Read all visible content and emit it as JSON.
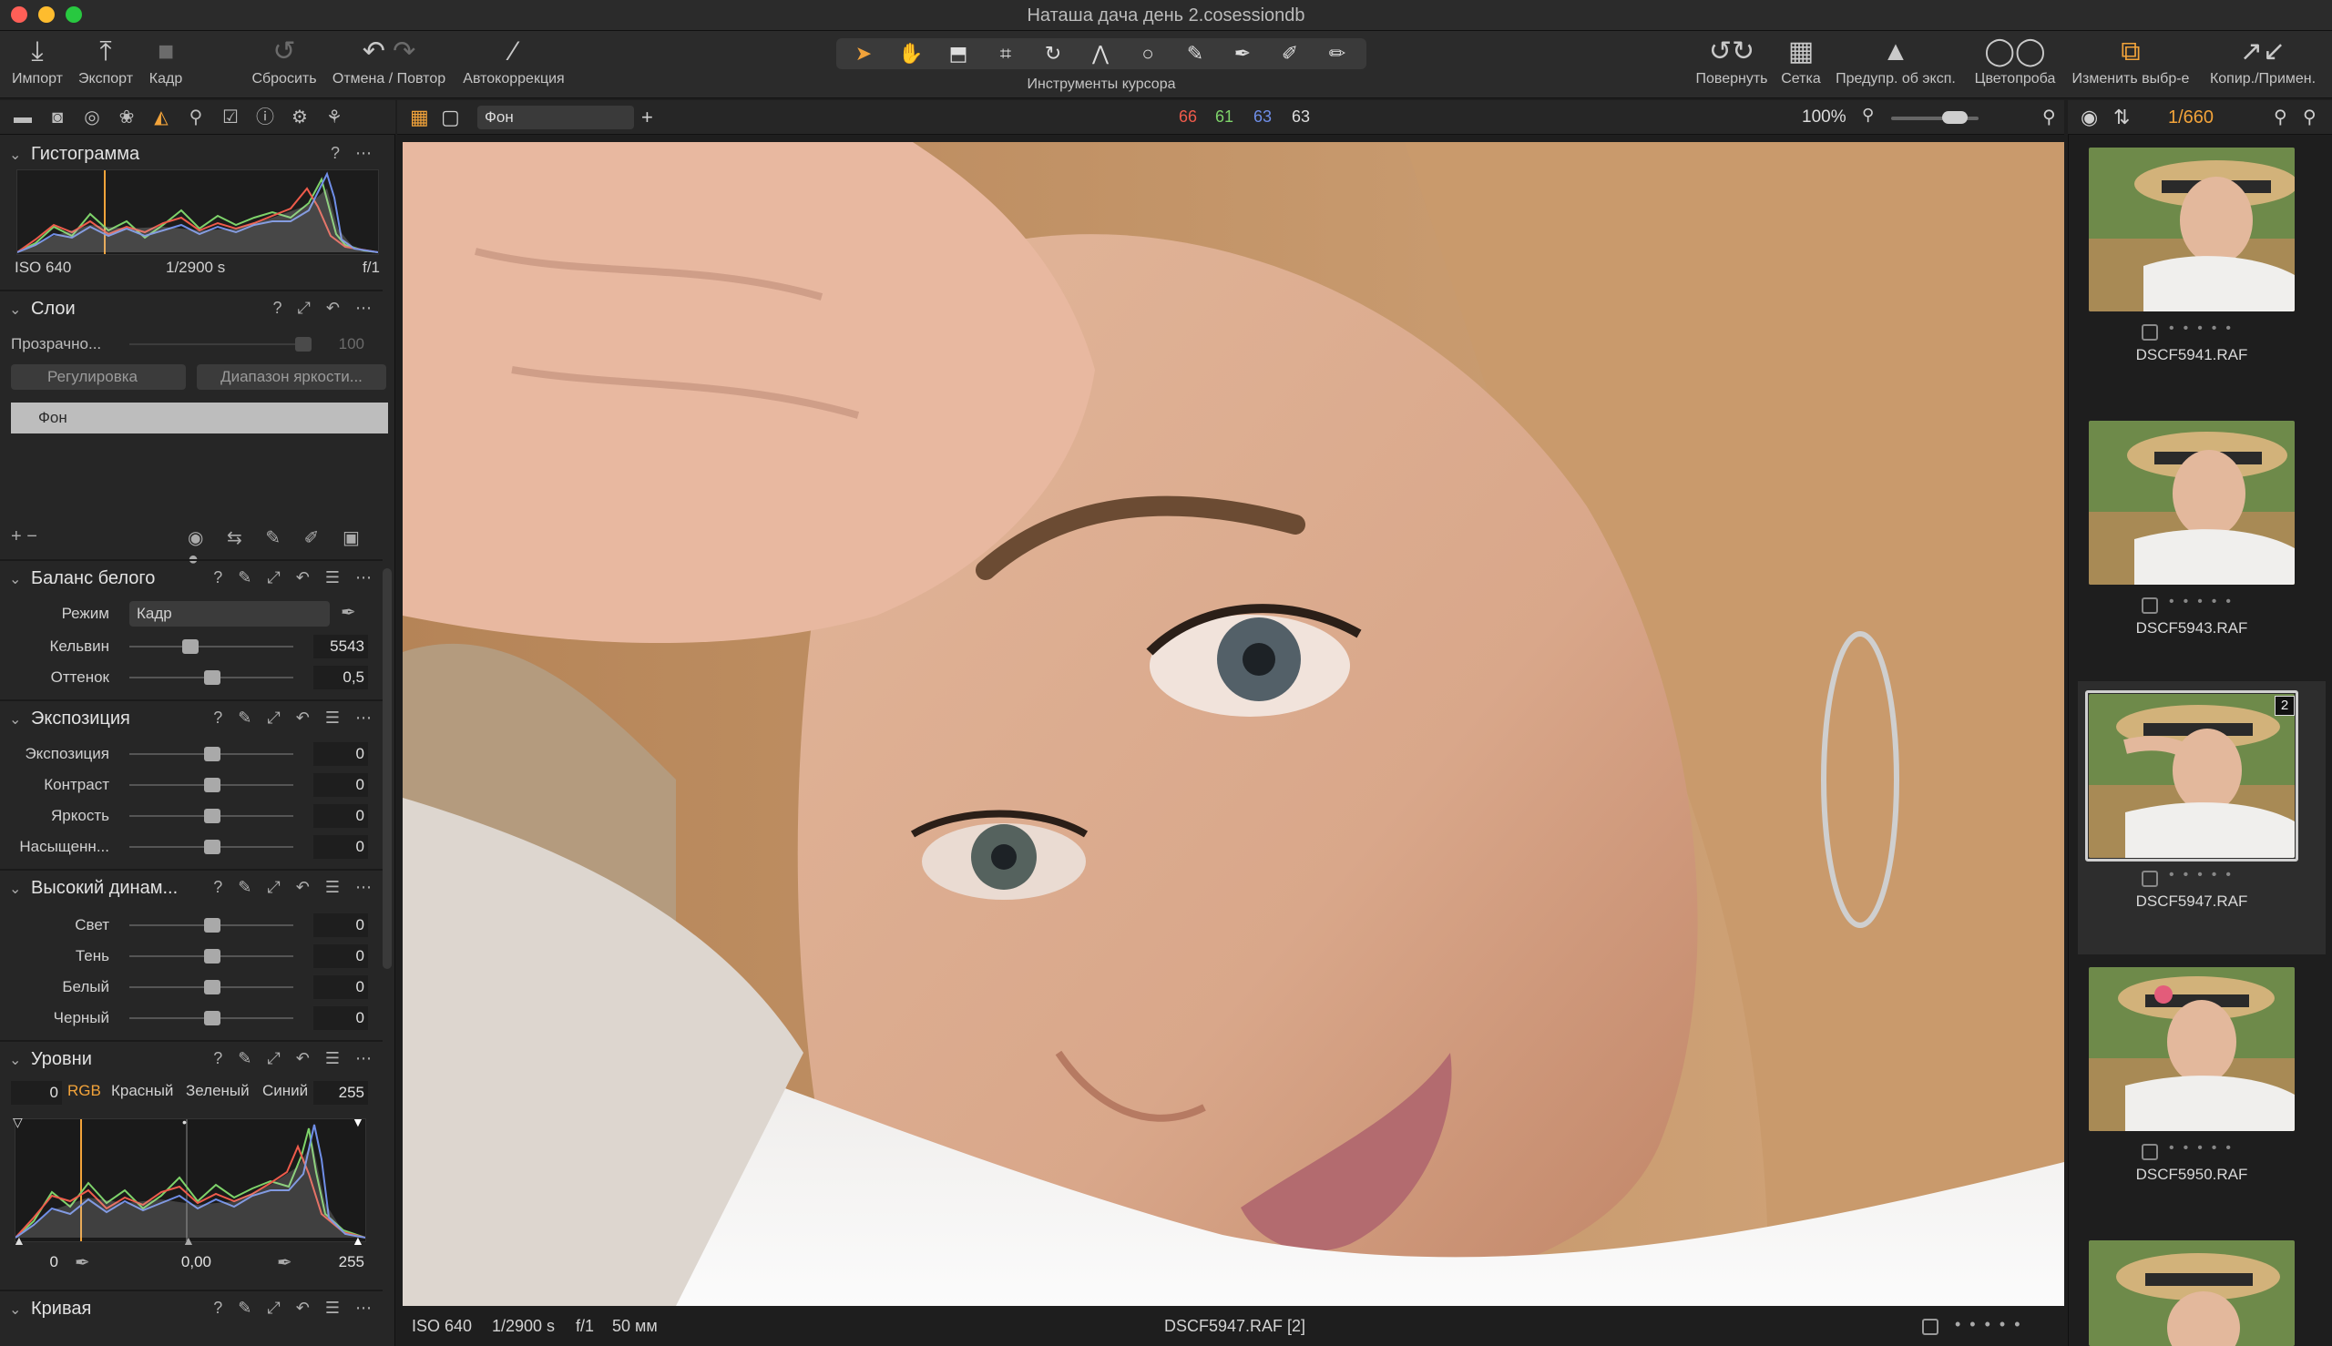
{
  "window": {
    "title": "Наташа дача день 2.cosessiondb"
  },
  "toolbar": {
    "import": "Импорт",
    "export": "Экспорт",
    "capture": "Кадр",
    "reset": "Сбросить",
    "undo_redo": "Отмена / Повтор",
    "autocorrect": "Автокоррекция",
    "cursor_tools": "Инструменты курсора",
    "rotate": "Повернуть",
    "grid": "Сетка",
    "exposure_warning": "Предупр. об эксп.",
    "proof": "Цветопроба",
    "edit_selection": "Изменить выбр-е",
    "copy_apply": "Копир./Примен."
  },
  "histogram": {
    "title": "Гистограмма",
    "iso": "ISO 640",
    "shutter": "1/2900 s",
    "aperture": "f/1"
  },
  "layers": {
    "title": "Слои",
    "opacity_label": "Прозрачно...",
    "opacity_value": "100",
    "adjust_button": "Регулировка",
    "luma_range_button": "Диапазон яркости...",
    "background_layer": "Фон"
  },
  "white_balance": {
    "title": "Баланс белого",
    "mode_label": "Режим",
    "mode_value": "Кадр",
    "kelvin_label": "Кельвин",
    "kelvin_value": "5543",
    "tint_label": "Оттенок",
    "tint_value": "0,5"
  },
  "exposure": {
    "title": "Экспозиция",
    "rows": [
      {
        "label": "Экспозиция",
        "value": "0"
      },
      {
        "label": "Контраст",
        "value": "0"
      },
      {
        "label": "Яркость",
        "value": "0"
      },
      {
        "label": "Насыщенн...",
        "value": "0"
      }
    ]
  },
  "hdr": {
    "title": "Высокий динам...",
    "rows": [
      {
        "label": "Свет",
        "value": "0"
      },
      {
        "label": "Тень",
        "value": "0"
      },
      {
        "label": "Белый",
        "value": "0"
      },
      {
        "label": "Черный",
        "value": "0"
      }
    ]
  },
  "levels": {
    "title": "Уровни",
    "black_in": "0",
    "white_in": "255",
    "channels": [
      "RGB",
      "Красный",
      "Зеленый",
      "Синий"
    ],
    "black_out": "0",
    "mid_out": "0,00",
    "white_out": "255"
  },
  "curve": {
    "title": "Кривая"
  },
  "viewer": {
    "layer_select": "Фон",
    "rgb": {
      "r": "66",
      "g": "61",
      "b": "63",
      "l": "63"
    },
    "zoom": "100%",
    "footer": {
      "iso": "ISO 640",
      "shutter": "1/2900 s",
      "aperture": "f/1",
      "focal": "50 мм",
      "filename": "DSCF5947.RAF [2]"
    }
  },
  "browser": {
    "counter": "1/660",
    "items": [
      {
        "name": "DSCF5941.RAF"
      },
      {
        "name": "DSCF5943.RAF"
      },
      {
        "name": "DSCF5947.RAF",
        "badge": "2"
      },
      {
        "name": "DSCF5950.RAF"
      }
    ]
  },
  "colors": {
    "accent": "#f2a33a",
    "red": "#ef5b4b",
    "green": "#7ed36a",
    "blue": "#6f8ee8"
  }
}
